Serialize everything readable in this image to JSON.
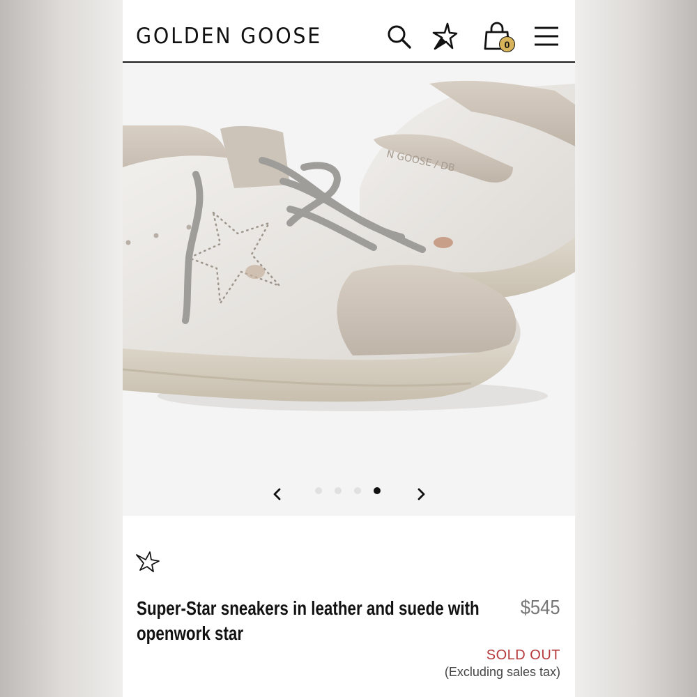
{
  "header": {
    "logo": "GOLDEN GOOSE",
    "icons": [
      "search-icon",
      "star-icon",
      "bag-icon",
      "menu-icon"
    ],
    "bag_count": "0"
  },
  "gallery": {
    "slides_total": 4,
    "active_slide": 4,
    "prev_icon": "chevron-left-icon",
    "next_icon": "chevron-right-icon"
  },
  "product": {
    "wishlist_icon": "star-outline-icon",
    "title": "Super-Star sneakers in leather and suede with openwork star",
    "price": "$545",
    "status": "SOLD OUT",
    "tax_note": "(Excluding sales tax)"
  },
  "colors": {
    "accent_badge": "#d7b35a",
    "sold_out": "#b5383b",
    "price": "#777777"
  }
}
